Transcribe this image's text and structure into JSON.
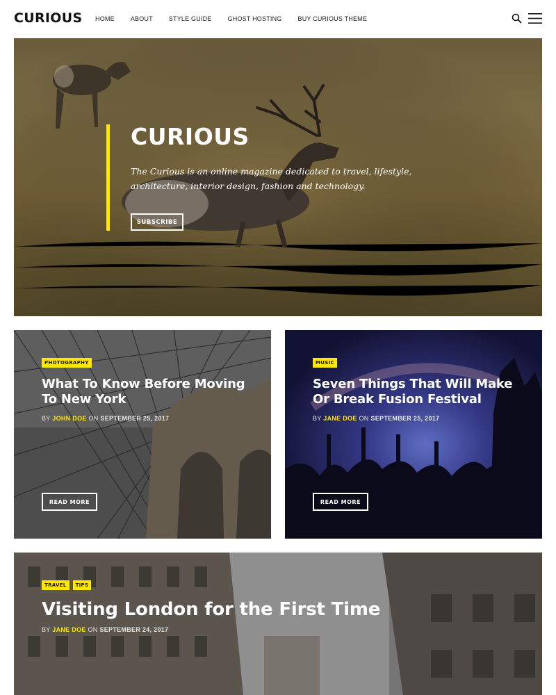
{
  "header": {
    "logo": "CURIOUS",
    "nav": [
      "HOME",
      "ABOUT",
      "STYLE GUIDE",
      "GHOST HOSTING",
      "BUY CURIOUS THEME"
    ]
  },
  "hero": {
    "title": "CURIOUS",
    "description": "The Curious is an online magazine dedicated to travel, lifestyle, architecture, interior design, fashion and technology.",
    "button": "SUBSCRIBE"
  },
  "posts": [
    {
      "tags": [
        "PHOTOGRAPHY"
      ],
      "title": "What To Know Before Moving To New York",
      "by": "BY",
      "author": "JOHN DOE",
      "on": "ON",
      "date": "SEPTEMBER 25, 2017",
      "button": "READ MORE"
    },
    {
      "tags": [
        "MUSIC"
      ],
      "title": "Seven Things That Will Make Or Break Fusion Festival",
      "by": "BY",
      "author": "JANE DOE",
      "on": "ON",
      "date": "SEPTEMBER 25, 2017",
      "button": "READ MORE"
    },
    {
      "tags": [
        "TRAVEL",
        "TIPS"
      ],
      "title": "Visiting London for the First Time",
      "by": "BY",
      "author": "JANE DOE",
      "on": "ON",
      "date": "SEPTEMBER 24, 2017"
    }
  ],
  "icons": {
    "search": "search-icon",
    "menu": "hamburger-menu-icon"
  },
  "colors": {
    "accent": "#ffe800",
    "text": "#111111"
  }
}
